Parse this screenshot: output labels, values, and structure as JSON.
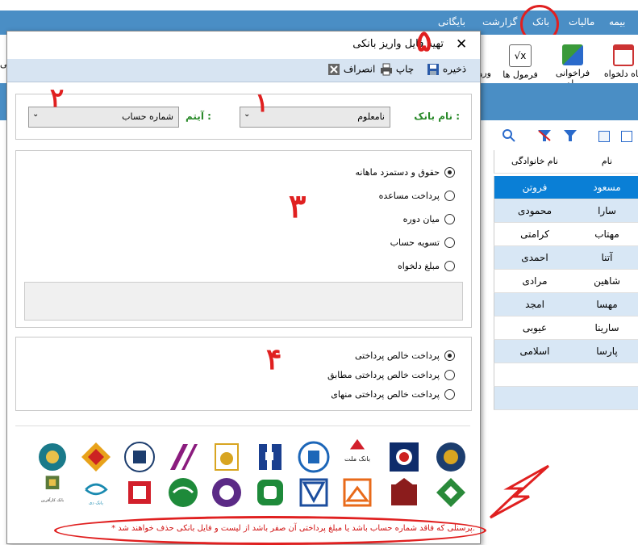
{
  "menubar": {
    "items": [
      "بیمه",
      "مالیات",
      "بانک",
      "گزارشت",
      "بایگانی"
    ]
  },
  "ribbon": {
    "buttons": [
      "ماه دلخواه",
      "فراخوانی ماه",
      "فرمول ها",
      "ورو"
    ],
    "left_fragment": "بی"
  },
  "grid": {
    "headers": [
      "نام",
      "نام خانوادگی"
    ],
    "rows": [
      [
        "مسعود",
        "فروتن"
      ],
      [
        "سارا",
        "محمودی"
      ],
      [
        "مهتاب",
        "کرامتی"
      ],
      [
        "آتنا",
        "احمدی"
      ],
      [
        "شاهین",
        "مرادی"
      ],
      [
        "مهسا",
        "امجد"
      ],
      [
        "سارینا",
        "عیوبی"
      ],
      [
        "پارسا",
        "اسلامی"
      ]
    ]
  },
  "dialog": {
    "title": "تهیه فایل واریز بانکی",
    "close": "✕",
    "toolbar": {
      "save": "ذخیره",
      "print": "چاپ",
      "cancel": "انصراف"
    },
    "bank_label": "نام بانک :",
    "bank_value": "نامعلوم",
    "item_label": "آیتم :",
    "item_value": "شماره حساب",
    "payment_options": [
      "حقوق و دستمزد ماهانه",
      "پرداخت مساعده",
      "میان دوره",
      "تسویه حساب",
      "مبلغ دلخواه"
    ],
    "payment_selected": 0,
    "amount_options": [
      "پرداخت خالص پرداختی",
      "پرداخت خالص پرداختی مطابق",
      "پرداخت خالص پرداختی منهای"
    ],
    "amount_selected": 0,
    "logo_texts": {
      "mellat": "بانک ملت",
      "karafarin": "بانک کارآفرین",
      "day": "بانک دی"
    },
    "footnote": "* پرسنلی که فاقد شماره حساب باشد یا مبلغ پرداختی آن صفر باشد از لیست و فایل بانکی حذف خواهند شد."
  },
  "annotations": {
    "n1": "١",
    "n2": "٢",
    "n3": "٣",
    "n4": "۴",
    "n5": "۵"
  },
  "colors": {
    "menubar": "#4a8ec5",
    "selected_row": "#0a7fd6",
    "annotation": "#e02020",
    "label_green": "#2a8a2a"
  }
}
